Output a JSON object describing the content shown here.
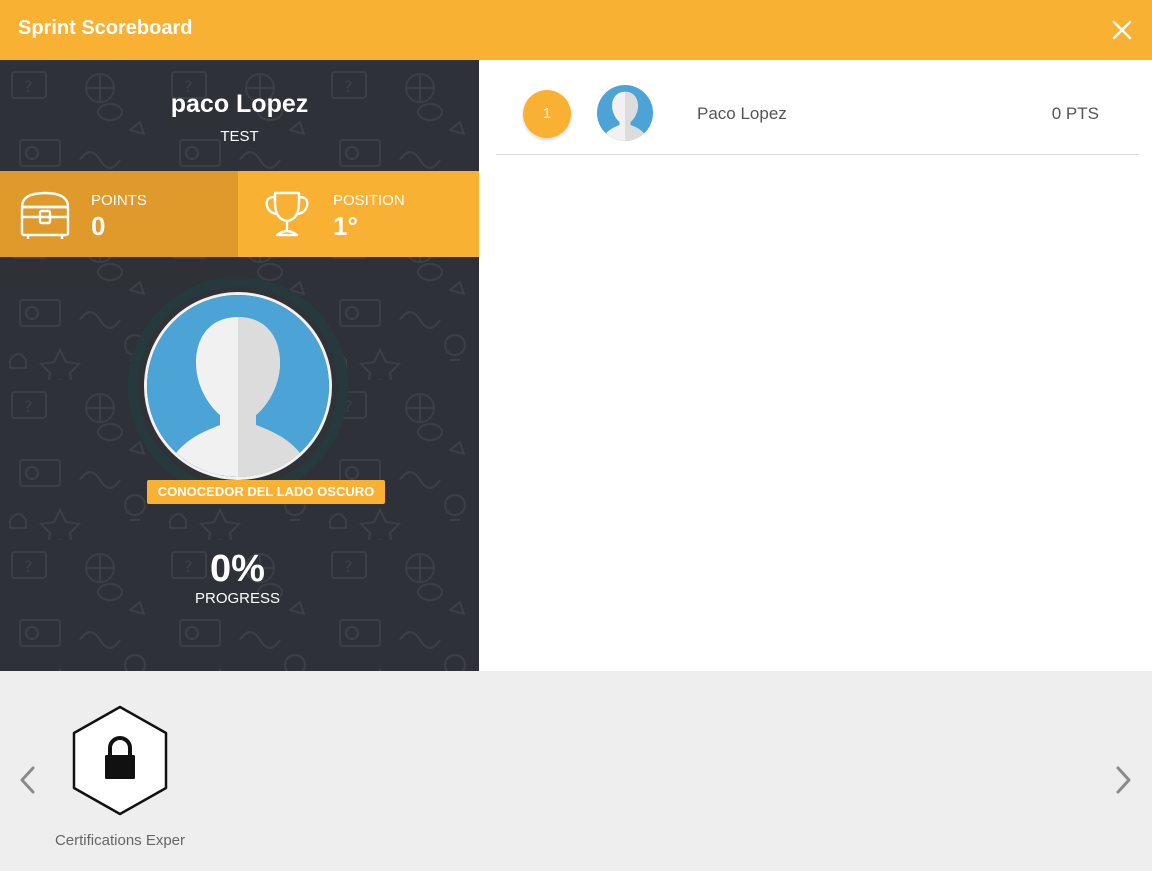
{
  "header": {
    "title": "Sprint Scoreboard",
    "close_icon": "close-icon"
  },
  "profile": {
    "name": "paco Lopez",
    "team": "TEST",
    "points_label": "POINTS",
    "points_value": "0",
    "position_label": "POSITION",
    "position_value": "1°",
    "level": "CONOCEDOR DEL LADO OSCURO",
    "progress_value": "0%",
    "progress_label": "PROGRESS",
    "progress_fraction": 0
  },
  "leaderboard": {
    "rows": [
      {
        "rank": "1",
        "name": "Paco Lopez",
        "points": "0 PTS"
      }
    ]
  },
  "badges": {
    "items": [
      {
        "label": "Certifications Exper",
        "locked": true,
        "icon": "lock-icon"
      }
    ],
    "prev_icon": "chevron-left-icon",
    "next_icon": "chevron-right-icon"
  },
  "colors": {
    "accent": "#f8b133",
    "accent_dark": "#e0992b",
    "panel": "#2e3138",
    "avatar_blue": "#4ba3d6"
  }
}
